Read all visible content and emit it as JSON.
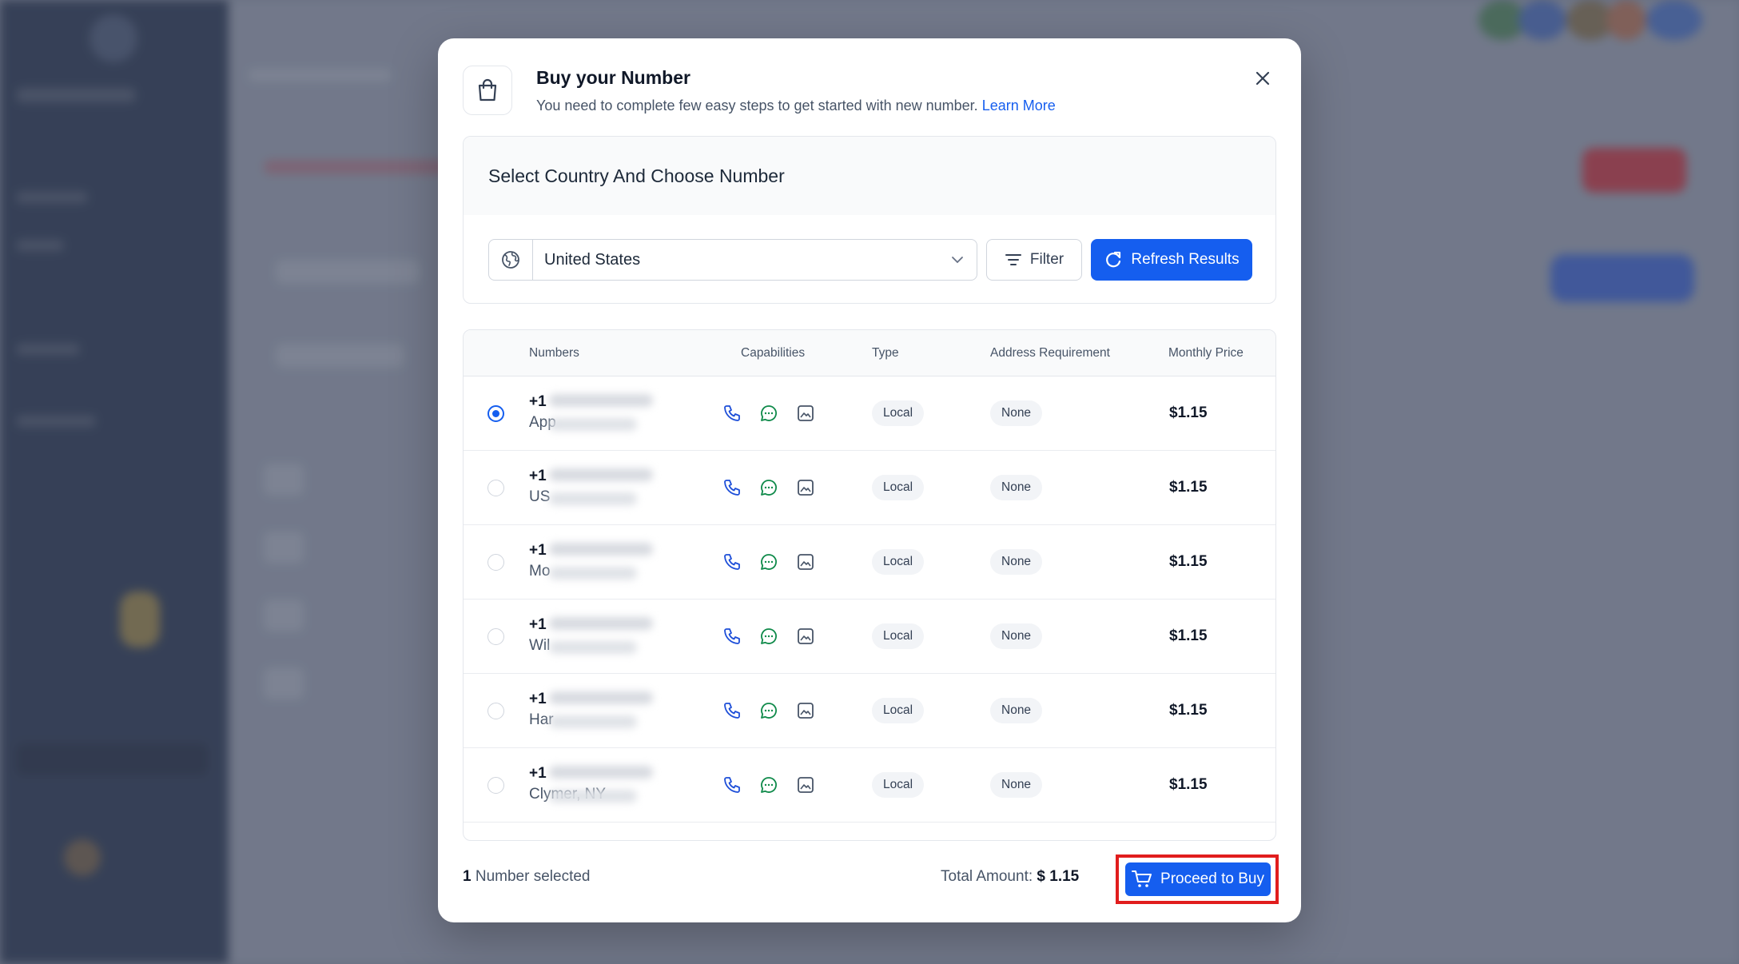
{
  "modal": {
    "title": "Buy your Number",
    "subtitle": "You need to complete few easy steps to get started with new number.",
    "learn_more": "Learn More"
  },
  "country_section": {
    "heading": "Select Country And Choose Number",
    "selected_country": "United States",
    "filter_label": "Filter",
    "refresh_label": "Refresh Results"
  },
  "table": {
    "columns": [
      "Numbers",
      "Capabilities",
      "Type",
      "Address Requirement",
      "Monthly Price"
    ],
    "rows": [
      {
        "prefix": "+1",
        "location": "App",
        "type": "Local",
        "address": "None",
        "price": "$1.15",
        "selected": true
      },
      {
        "prefix": "+1",
        "location": "US",
        "type": "Local",
        "address": "None",
        "price": "$1.15",
        "selected": false
      },
      {
        "prefix": "+1",
        "location": "Mo",
        "type": "Local",
        "address": "None",
        "price": "$1.15",
        "selected": false
      },
      {
        "prefix": "+1",
        "location": "Wil",
        "type": "Local",
        "address": "None",
        "price": "$1.15",
        "selected": false
      },
      {
        "prefix": "+1",
        "location": "Har",
        "type": "Local",
        "address": "None",
        "price": "$1.15",
        "selected": false
      },
      {
        "prefix": "+1",
        "location": "Clymer, NY",
        "type": "Local",
        "address": "None",
        "price": "$1.15",
        "selected": false
      }
    ]
  },
  "footer": {
    "selected_count": "1",
    "selected_label": "Number selected",
    "total_label": "Total Amount:",
    "total_value": "$ 1.15",
    "buy_label": "Proceed to Buy"
  },
  "colors": {
    "primary": "#155eef",
    "highlight": "#e11d1d",
    "phone_icon": "#1d4ed8",
    "sms_icon": "#0f8a4a"
  }
}
